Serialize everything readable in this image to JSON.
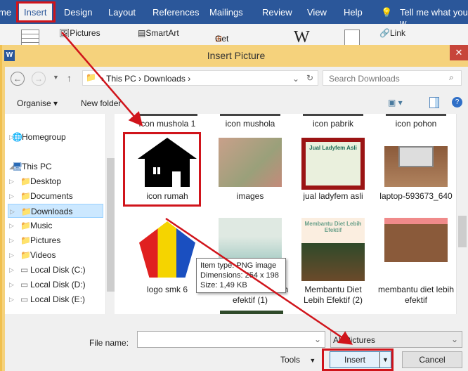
{
  "ribbon_tabs": [
    "me",
    "Insert",
    "Design",
    "Layout",
    "References",
    "Mailings",
    "Review",
    "View",
    "Help",
    "Tell me what you w"
  ],
  "ribbon": {
    "pictures": "Pictures",
    "smartart": "SmartArt",
    "get_addins": "Get Add-ins",
    "wiki": "W",
    "link": "Link"
  },
  "dialog": {
    "title": "Insert Picture",
    "close": "✕",
    "app_icon": "W"
  },
  "address": {
    "crumbs": [
      "This PC",
      "Downloads"
    ],
    "search_placeholder": "Search Downloads"
  },
  "toolbar": {
    "organise": "Organise ▾",
    "new_folder": "New folder"
  },
  "sidebar": [
    {
      "label": "Homegroup",
      "icon": "homegroup-icon"
    },
    {
      "label": "This PC",
      "icon": "computer-icon"
    },
    {
      "label": "Desktop",
      "icon": "folder-icon"
    },
    {
      "label": "Documents",
      "icon": "folder-icon"
    },
    {
      "label": "Downloads",
      "icon": "folder-icon",
      "selected": true
    },
    {
      "label": "Music",
      "icon": "folder-icon"
    },
    {
      "label": "Pictures",
      "icon": "folder-icon"
    },
    {
      "label": "Videos",
      "icon": "folder-icon"
    },
    {
      "label": "Local Disk (C:)",
      "icon": "drive-icon"
    },
    {
      "label": "Local Disk (D:)",
      "icon": "drive-icon"
    },
    {
      "label": "Local Disk (E:)",
      "icon": "drive-icon"
    }
  ],
  "files": [
    {
      "name": "icon mushola 1"
    },
    {
      "name": "icon mushola"
    },
    {
      "name": "icon pabrik"
    },
    {
      "name": "icon pohon"
    },
    {
      "name": "icon rumah",
      "selected": true
    },
    {
      "name": "images"
    },
    {
      "name": "jual ladyfem asli",
      "thumb_text": "Jual Ladyfem Asli"
    },
    {
      "name": "laptop-593673_640"
    },
    {
      "name": "logo smk 6"
    },
    {
      "name": "membantu diet lebih efektif (1)"
    },
    {
      "name": "Membantu Diet Lebih Efektif (2)",
      "thumb_text": "Membantu Diet Lebih Efektif"
    },
    {
      "name": "membantu diet lebih efektif"
    }
  ],
  "tooltip": {
    "type": "Item type: PNG image",
    "dimensions": "Dimensions: 254 x 198",
    "size": "Size: 1,49 KB"
  },
  "footer": {
    "file_name_label": "File name:",
    "file_name_value": "",
    "filter": "All Pictures",
    "tools": "Tools",
    "insert": "Insert",
    "cancel": "Cancel"
  },
  "colors": {
    "ribbon_blue": "#2b579a",
    "dialog_border": "#f5d27c",
    "annotation_red": "#d0141b",
    "selection": "#cce8ff"
  }
}
